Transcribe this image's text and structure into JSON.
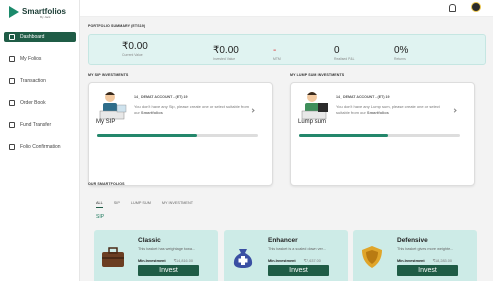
{
  "app": {
    "brand": "Smartfolios",
    "brand_sub": "By Jack"
  },
  "sidebar": {
    "items": [
      {
        "label": "Dashboard",
        "icon": "dashboard-icon",
        "active": true
      },
      {
        "label": "My Folios",
        "icon": "folder-icon"
      },
      {
        "label": "Transaction",
        "icon": "transaction-icon"
      },
      {
        "label": "Order Book",
        "icon": "order-book-icon"
      },
      {
        "label": "Fund Transfer",
        "icon": "fund-transfer-icon"
      },
      {
        "label": "Folio Confirmation",
        "icon": "folio-confirmation-icon"
      }
    ]
  },
  "summary": {
    "title": "PORTFOLIO SUMMARY (ETS19)",
    "stats": [
      {
        "value": "₹0.00",
        "label": "Current Value"
      },
      {
        "value": "₹0.00",
        "label": "Invested Value"
      },
      {
        "value": "-",
        "label": "MTM"
      },
      {
        "value": "0",
        "label": "Realised P&L"
      },
      {
        "value": "0%",
        "label": "Returns"
      }
    ]
  },
  "sip": {
    "section_title": "MY SIP INVESTMENTS",
    "account": "14_ DEMAT ACCOUNT - (ET) 19",
    "desc_prefix": "You don't have any Sip, please create one or select suitable from our ",
    "desc_link": "Smartfolios",
    "label": "My SIP",
    "progress": 0.62
  },
  "lumpsum": {
    "section_title": "MY LUMP SUM INVESTMENTS",
    "account": "14_ DEMAT ACCOUNT - (ET) 19",
    "desc_prefix": "You don't have any Lump sum, please create one or select suitable from our ",
    "desc_link": "Smartfolios",
    "label": "Lump sum",
    "progress": 0.55
  },
  "smartfolios": {
    "section_title": "OUR SMARTFOLIOS",
    "tabs": [
      "ALL",
      "SIP",
      "LUMP SUM",
      "MY INVESTMENT"
    ],
    "active_tab": "ALL",
    "sub_label": "SIP",
    "min_label": "Min.Investment",
    "invest_label": "Invest",
    "cards": [
      {
        "name": "Classic",
        "desc": "This basket has weightage towa...",
        "min": "₹14,816.00"
      },
      {
        "name": "Enhancer",
        "desc": "This basket is a scaled down ver...",
        "min": "₹7,637.00"
      },
      {
        "name": "Defensive",
        "desc": "This basket gives more weighte...",
        "min": "₹18,283.00"
      }
    ]
  }
}
